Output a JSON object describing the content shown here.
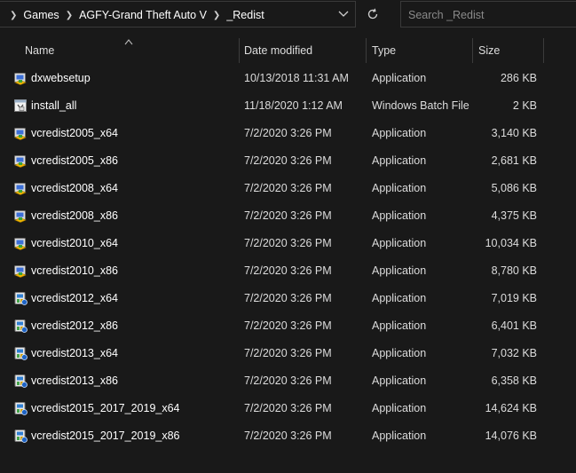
{
  "address_bar": {
    "breadcrumbs": [
      "Games",
      "AGFY-Grand Theft Auto V",
      "_Redist"
    ]
  },
  "search": {
    "placeholder": "Search _Redist"
  },
  "columns": {
    "name": "Name",
    "date": "Date modified",
    "type": "Type",
    "size": "Size"
  },
  "icons": {
    "dropdown": "chevron-down-icon",
    "refresh": "refresh-icon",
    "sort": "sort-up-icon",
    "application": "setup-application-icon",
    "batch": "batch-file-icon",
    "installer": "installer-application-icon"
  },
  "colors": {
    "background": "#191919",
    "text": "#ffffff",
    "divider": "#3c3c3c"
  },
  "files": [
    {
      "name": "dxwebsetup",
      "date": "10/13/2018 11:31 AM",
      "type": "Application",
      "size": "286 KB",
      "icon": "setup-application-icon"
    },
    {
      "name": "install_all",
      "date": "11/18/2020 1:12 AM",
      "type": "Windows Batch File",
      "size": "2 KB",
      "icon": "batch-file-icon"
    },
    {
      "name": "vcredist2005_x64",
      "date": "7/2/2020 3:26 PM",
      "type": "Application",
      "size": "3,140 KB",
      "icon": "setup-application-icon"
    },
    {
      "name": "vcredist2005_x86",
      "date": "7/2/2020 3:26 PM",
      "type": "Application",
      "size": "2,681 KB",
      "icon": "setup-application-icon"
    },
    {
      "name": "vcredist2008_x64",
      "date": "7/2/2020 3:26 PM",
      "type": "Application",
      "size": "5,086 KB",
      "icon": "setup-application-icon"
    },
    {
      "name": "vcredist2008_x86",
      "date": "7/2/2020 3:26 PM",
      "type": "Application",
      "size": "4,375 KB",
      "icon": "setup-application-icon"
    },
    {
      "name": "vcredist2010_x64",
      "date": "7/2/2020 3:26 PM",
      "type": "Application",
      "size": "10,034 KB",
      "icon": "setup-application-icon"
    },
    {
      "name": "vcredist2010_x86",
      "date": "7/2/2020 3:26 PM",
      "type": "Application",
      "size": "8,780 KB",
      "icon": "setup-application-icon"
    },
    {
      "name": "vcredist2012_x64",
      "date": "7/2/2020 3:26 PM",
      "type": "Application",
      "size": "7,019 KB",
      "icon": "installer-application-icon"
    },
    {
      "name": "vcredist2012_x86",
      "date": "7/2/2020 3:26 PM",
      "type": "Application",
      "size": "6,401 KB",
      "icon": "installer-application-icon"
    },
    {
      "name": "vcredist2013_x64",
      "date": "7/2/2020 3:26 PM",
      "type": "Application",
      "size": "7,032 KB",
      "icon": "installer-application-icon"
    },
    {
      "name": "vcredist2013_x86",
      "date": "7/2/2020 3:26 PM",
      "type": "Application",
      "size": "6,358 KB",
      "icon": "installer-application-icon"
    },
    {
      "name": "vcredist2015_2017_2019_x64",
      "date": "7/2/2020 3:26 PM",
      "type": "Application",
      "size": "14,624 KB",
      "icon": "installer-application-icon"
    },
    {
      "name": "vcredist2015_2017_2019_x86",
      "date": "7/2/2020 3:26 PM",
      "type": "Application",
      "size": "14,076 KB",
      "icon": "installer-application-icon"
    }
  ]
}
